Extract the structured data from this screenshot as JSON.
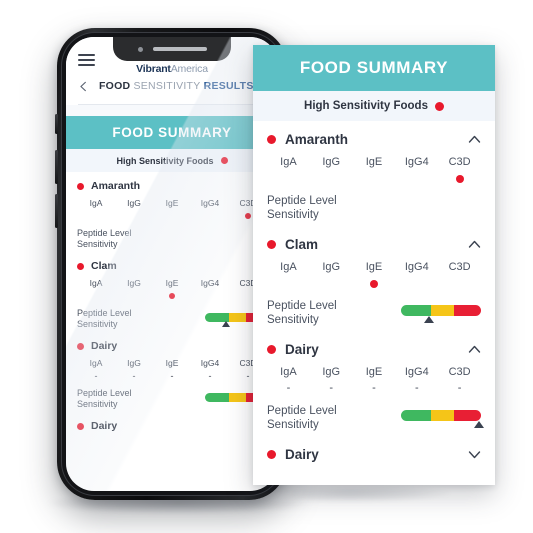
{
  "app": {
    "brand_primary": "Vibrant",
    "brand_secondary": "America",
    "menu_icon": "hamburger-menu-icon",
    "back_icon": "back-chevron-icon",
    "breadcrumb": {
      "part1": "FOOD",
      "part2": "SENSITIVITY",
      "part3": "RESULTS"
    }
  },
  "card": {
    "title": "FOOD SUMMARY",
    "subtitle": "High Sensitivity Foods",
    "subtitle_dot": "red-severity-dot",
    "marker_columns": [
      "IgA",
      "IgG",
      "IgE",
      "IgG4",
      "C3D"
    ],
    "peptide_label_line1": "Peptide Level",
    "peptide_label_line2": "Sensitivity"
  },
  "foods": [
    {
      "name": "Amaranth",
      "expanded": true,
      "chevron": "chevron-up-icon",
      "values": [
        "",
        "",
        "",
        "",
        "dot"
      ],
      "gauge": null
    },
    {
      "name": "Clam",
      "expanded": true,
      "chevron": "chevron-up-icon",
      "values": [
        "",
        "",
        "dot",
        "",
        ""
      ],
      "gauge": {
        "marker_percent": 35,
        "green_percent": 38,
        "yellow_percent": 28,
        "red_percent": 34
      }
    },
    {
      "name": "Dairy",
      "expanded": true,
      "chevron": "chevron-up-icon",
      "values": [
        "-",
        "-",
        "-",
        "-",
        "-"
      ],
      "gauge": {
        "marker_percent": 97,
        "green_percent": 38,
        "yellow_percent": 28,
        "red_percent": 34
      }
    },
    {
      "name": "Dairy",
      "expanded": false,
      "chevron": "chevron-down-icon",
      "values": [],
      "gauge": null
    }
  ],
  "colors": {
    "teal_header": "#5CC0C5",
    "subtitle_band": "#F2F6FB",
    "severity_red": "#E8192C",
    "gauge_green": "#3FB860",
    "gauge_yellow": "#F5C518",
    "gauge_red": "#E81F34",
    "marker_triangle": "#3A4250",
    "brand_navy": "#1D3557",
    "breadcrumb_blue": "#1D4F8F"
  }
}
